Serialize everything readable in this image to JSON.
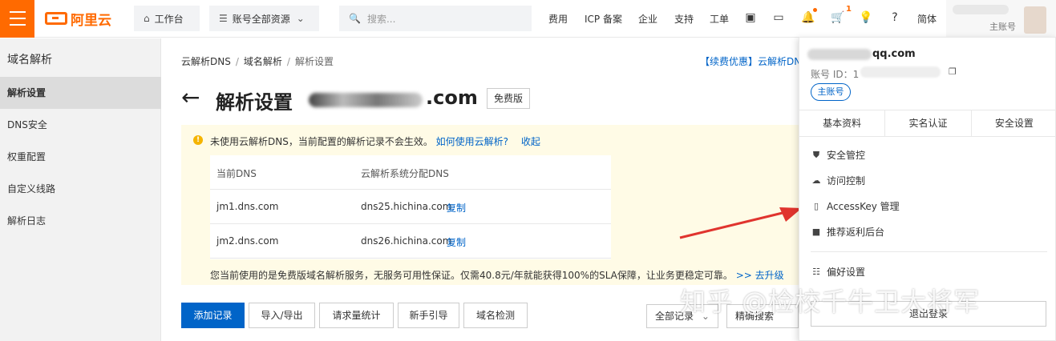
{
  "topbar": {
    "logo": "阿里云",
    "workbench": "工作台",
    "resources": "账号全部资源",
    "search_placeholder": "搜索...",
    "links": [
      "费用",
      "ICP 备案",
      "企业",
      "支持",
      "工单"
    ],
    "notification_count": "1",
    "lang": "简体",
    "account_role": "主账号"
  },
  "sidebar": {
    "title": "域名解析",
    "items": [
      {
        "label": "解析设置",
        "active": true
      },
      {
        "label": "DNS安全"
      },
      {
        "label": "权重配置"
      },
      {
        "label": "自定义线路"
      },
      {
        "label": "解析日志"
      }
    ]
  },
  "breadcrumb": [
    "云解析DNS",
    "域名解析",
    "解析设置"
  ],
  "promo": "【续费优惠】云解析DNS",
  "page": {
    "title": "解析设置",
    "domain_suffix": ".com",
    "edition": "免费版"
  },
  "notice": {
    "text": "未使用云解析DNS，当前配置的解析记录不会生效。",
    "help_link": "如何使用云解析?",
    "collapse": "收起",
    "table": {
      "headers": [
        "当前DNS",
        "云解析系统分配DNS"
      ],
      "rows": [
        {
          "current": "jm1.dns.com",
          "assigned": "dns25.hichina.com",
          "copy": "复制"
        },
        {
          "current": "jm2.dns.com",
          "assigned": "dns26.hichina.com",
          "copy": "复制"
        }
      ]
    },
    "footer": "您当前使用的是免费版域名解析服务，无服务可用性保证。仅需40.8元/年就能获得100%的SLA保障，让业务更稳定可靠。",
    "upgrade": ">> 去升级"
  },
  "actions": [
    "添加记录",
    "导入/导出",
    "请求量统计",
    "新手引导",
    "域名检测"
  ],
  "filters": {
    "all_records": "全部记录",
    "exact_search": "精确搜索"
  },
  "dropdown": {
    "email_suffix": "qq.com",
    "account_id_label": "账号 ID：",
    "account_id_prefix": "1",
    "main_tag": "主账号",
    "tabs": [
      "基本资料",
      "实名认证",
      "安全设置"
    ],
    "items": [
      "安全管控",
      "访问控制",
      "AccessKey 管理",
      "推荐返利后台"
    ],
    "preferences": "偏好设置",
    "logout": "退出登录"
  },
  "watermark": "知乎 @检校千牛卫大将军",
  "colors": {
    "brand": "#ff6a00",
    "primary": "#0064c8",
    "notice_bg": "#fffbe6",
    "annotation_arrow": "#e0342e"
  }
}
